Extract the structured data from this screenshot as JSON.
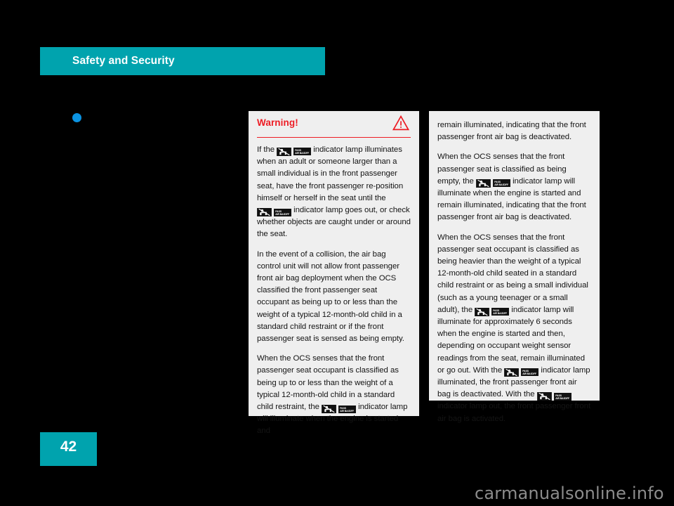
{
  "header": {
    "chapter_title": "Safety and Security",
    "band_color": "#00A3AE"
  },
  "bullet": {
    "name": "section-bullet",
    "color": "#0B93E2"
  },
  "warning_box": {
    "title": "Warning!",
    "title_color": "#ED1C24",
    "icon": "warning-triangle-icon",
    "paragraphs": [
      {
        "id": "warn-p1",
        "segments": [
          {
            "type": "text",
            "value": "If the "
          },
          {
            "type": "icon",
            "value": "passenger-air-bag-off-indicator"
          },
          {
            "type": "text",
            "value": " indicator lamp illuminates when an adult or someone larger than a small individual is in the front passenger seat, have the front passenger re-position himself or herself in the seat until the "
          },
          {
            "type": "icon",
            "value": "passenger-air-bag-off-indicator"
          },
          {
            "type": "text",
            "value": " indicator lamp goes out, or check whether objects are caught under or around the seat."
          }
        ]
      },
      {
        "id": "warn-p2",
        "segments": [
          {
            "type": "text",
            "value": "In the event of a collision, the air bag control unit will not allow front passenger front air bag deployment when the OCS classified the front passenger seat occupant as being up to or less than the weight of a typical 12-month-old child in a standard child restraint or if the front passenger seat is sensed as being empty."
          }
        ]
      },
      {
        "id": "warn-p3",
        "segments": [
          {
            "type": "text",
            "value": "When the OCS senses that the front passenger seat occupant is classified as being up to or less than the weight of a typical 12-month-old child in a standard child restraint, the "
          },
          {
            "type": "icon",
            "value": "passenger-air-bag-off-indicator"
          },
          {
            "type": "text",
            "value": " indicator lamp will illuminate when the engine is started and"
          }
        ]
      }
    ]
  },
  "continuation_box": {
    "paragraphs": [
      {
        "id": "cont-p1",
        "segments": [
          {
            "type": "text",
            "value": "remain illuminated, indicating that the front passenger front air bag is deactivated."
          }
        ]
      },
      {
        "id": "cont-p2",
        "segments": [
          {
            "type": "text",
            "value": "When the OCS senses that the front passenger seat is classified as being empty, the "
          },
          {
            "type": "icon",
            "value": "passenger-air-bag-off-indicator"
          },
          {
            "type": "text",
            "value": " indicator lamp will illuminate when the engine is started and remain illuminated, indicating that the front passenger front air bag is deactivated."
          }
        ]
      },
      {
        "id": "cont-p3",
        "segments": [
          {
            "type": "text",
            "value": "When the OCS senses that the front passenger seat occupant is classified as being heavier than the weight of a typical 12-month-old child seated in a standard child restraint or as being a small individual (such as a young teenager or a small adult), the "
          },
          {
            "type": "icon",
            "value": "passenger-air-bag-off-indicator"
          },
          {
            "type": "text",
            "value": " indicator lamp will illuminate for approximately 6 seconds when the engine is started and then, depending on occupant weight sensor readings from the seat, remain illuminated or go out. With the "
          },
          {
            "type": "icon",
            "value": "passenger-air-bag-off-indicator"
          },
          {
            "type": "text",
            "value": " indicator lamp illuminated, the front passenger front air bag is deactivated. With the "
          },
          {
            "type": "icon",
            "value": "passenger-air-bag-off-indicator"
          },
          {
            "type": "text",
            "value": " indicator lamp out, the front passenger front air bag is activated."
          }
        ]
      }
    ]
  },
  "indicator_lamp": {
    "child_symbol_label": "child-in-seat-crossed-out",
    "text_badge_line1": "PASS",
    "text_badge_line2": "AIR BAG",
    "text_badge_line3": "OFF"
  },
  "footer": {
    "page_number": "42",
    "page_tab_color": "#00A3AE",
    "watermark": "carmanualsonline.info"
  }
}
